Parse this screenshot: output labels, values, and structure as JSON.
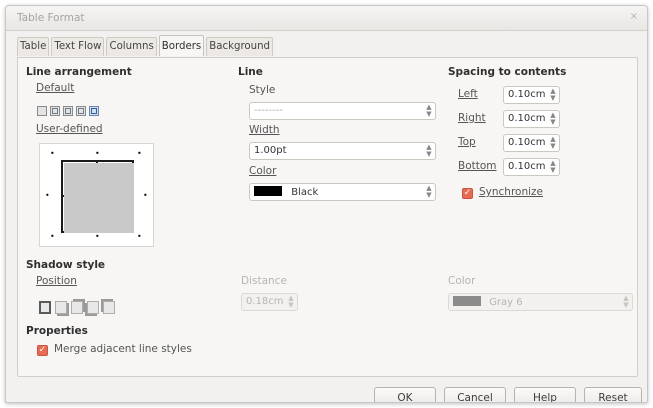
{
  "window": {
    "title": "Table Format",
    "close_glyph": "×"
  },
  "tabs": [
    {
      "label": "Table",
      "active": false
    },
    {
      "label": "Text Flow",
      "active": false
    },
    {
      "label": "Columns",
      "active": false
    },
    {
      "label": "Borders",
      "active": true
    },
    {
      "label": "Background",
      "active": false
    }
  ],
  "line_arrangement": {
    "heading": "Line arrangement",
    "default_label": "Default",
    "user_defined_label": "User-defined",
    "preset_count": 5
  },
  "line": {
    "heading": "Line",
    "style_label": "Style",
    "style_value": "--------",
    "width_label": "Width",
    "width_value": "1.00pt",
    "color_label": "Color",
    "color_value": "Black",
    "color_swatch": "#000000"
  },
  "spacing": {
    "heading": "Spacing to contents",
    "left_label": "Left",
    "left_value": "0.10cm",
    "right_label": "Right",
    "right_value": "0.10cm",
    "top_label": "Top",
    "top_value": "0.10cm",
    "bottom_label": "Bottom",
    "bottom_value": "0.10cm",
    "synchronize_label": "Synchronize",
    "synchronize_checked": true
  },
  "shadow": {
    "heading": "Shadow style",
    "position_label": "Position",
    "position_count": 5,
    "distance_label": "Distance",
    "distance_value": "0.18cm",
    "color_label": "Color",
    "color_value": "Gray 6",
    "color_swatch": "#777777"
  },
  "properties": {
    "heading": "Properties",
    "merge_label": "Merge adjacent line styles",
    "merge_checked": true
  },
  "buttons": {
    "ok": "OK",
    "cancel": "Cancel",
    "help": "Help",
    "reset": "Reset"
  },
  "colors": {
    "accent": "#e76b52",
    "dialog_bg": "#f2f1f0",
    "panel_bg": "#f7f6f5"
  }
}
